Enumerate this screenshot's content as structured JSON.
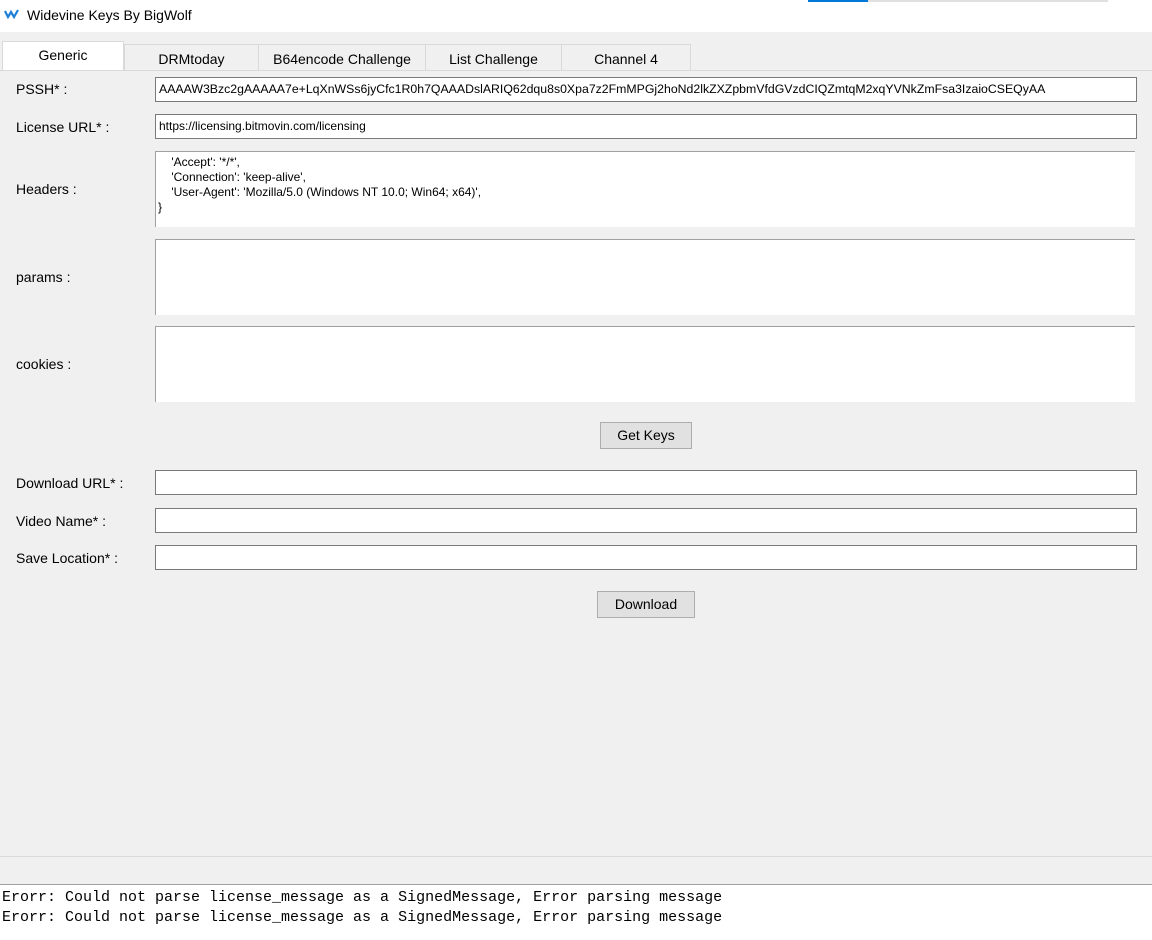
{
  "window": {
    "title": "Widevine Keys By BigWolf"
  },
  "tabs": [
    "Generic",
    "DRMtoday",
    "B64encode Challenge",
    "List Challenge",
    "Channel 4"
  ],
  "form": {
    "pssh_label": "PSSH* :",
    "pssh_value": "AAAAW3Bzc2gAAAAA7e+LqXnWSs6jyCfc1R0h7QAAADslARIQ62dqu8s0Xpa7z2FmMPGj2hoNd2lkZXZpbmVfdGVzdCIQZmtqM2xqYVNkZmFsa3IzaioCSEQyAA",
    "license_label": "License URL* :",
    "license_value": "https://licensing.bitmovin.com/licensing",
    "headers_label": "Headers :",
    "headers_value": "    'Accept': '*/*',\n    'Connection': 'keep-alive',\n    'User-Agent': 'Mozilla/5.0 (Windows NT 10.0; Win64; x64)',\n}",
    "params_label": "params :",
    "params_value": "",
    "cookies_label": "cookies :",
    "cookies_value": "",
    "get_keys": "Get Keys",
    "download_url_label": "Download URL* :",
    "download_url_value": "",
    "video_name_label": "Video Name* :",
    "video_name_value": "",
    "save_location_label": "Save Location* :",
    "save_location_value": "",
    "download": "Download"
  },
  "log": "Erorr: Could not parse license_message as a SignedMessage, Error parsing message\nErorr: Could not parse license_message as a SignedMessage, Error parsing message",
  "colors": {
    "accent": "#0078d7"
  }
}
